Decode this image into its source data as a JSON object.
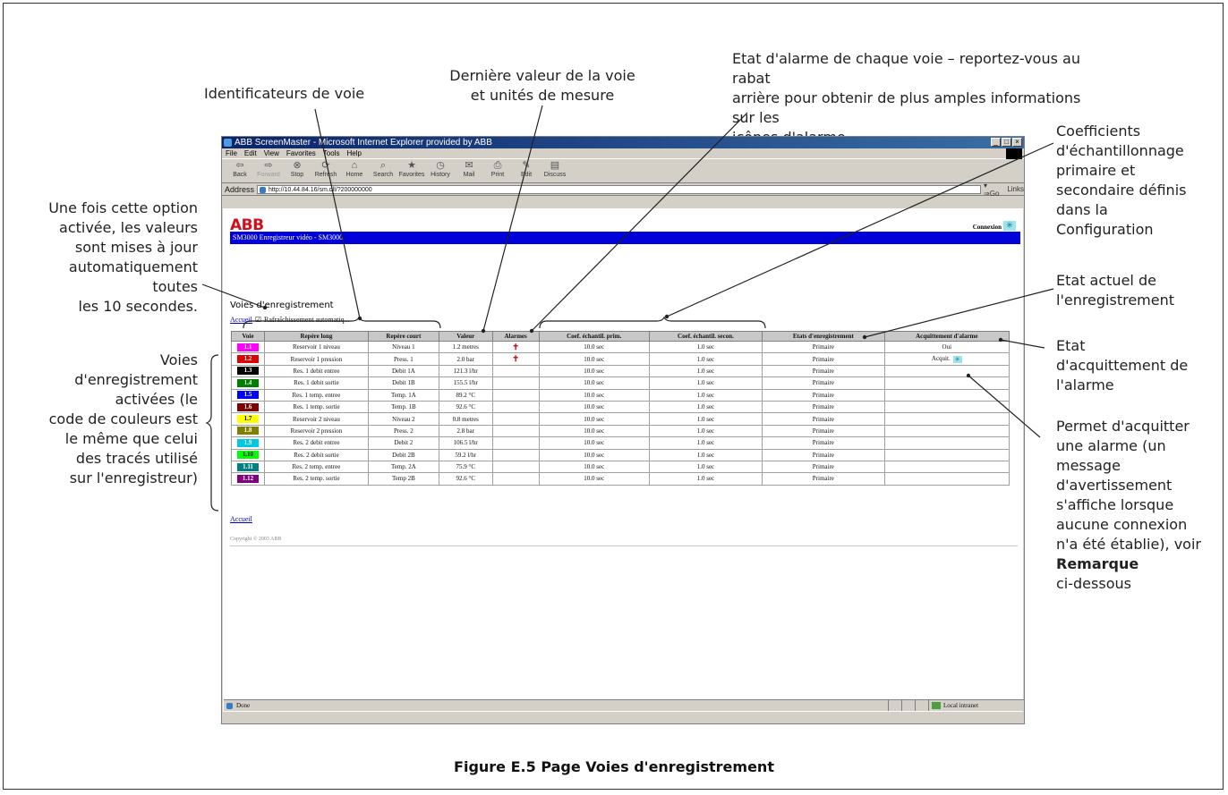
{
  "callouts": {
    "auto_refresh": [
      "Une fois cette option",
      "activée, les valeurs",
      "sont mises à jour",
      "automatiquement",
      "toutes",
      "les 10 secondes."
    ],
    "channel_ids": [
      "Identificateurs de voie"
    ],
    "last_value": [
      "Dernière valeur de la voie",
      "et unités de mesure"
    ],
    "alarm_state": [
      "Etat d'alarme de chaque voie – reportez-vous au rabat",
      "arrière pour obtenir de plus amples informations sur les",
      "icônes d'alarme"
    ],
    "sampling": [
      "Coefficients",
      "d'échantillonnage",
      "primaire et",
      "secondaire définis",
      "dans la",
      "Configuration"
    ],
    "recording_state": [
      "Etat actuel de",
      "l'enregistrement"
    ],
    "ack_state": [
      "Etat",
      "d'acquittement de",
      "l'alarme"
    ],
    "channels_enabled": [
      "Voies",
      "d'enregistrement",
      "activées (le",
      "code de couleurs est",
      "le même que celui",
      "des tracés utilisé",
      "sur l'enregistreur)"
    ],
    "ack_action": [
      "Permet d'acquitter",
      "une alarme (un",
      "message",
      "d'avertissement",
      "s'affiche lorsque",
      "aucune connexion",
      "n'a été établie), voir"
    ],
    "ack_note_bold": "Remarque",
    "ack_note_rest": "ci-dessous"
  },
  "caption": "Figure E.5 Page Voies d'enregistrement",
  "browser": {
    "title": "ABB ScreenMaster - Microsoft Internet Explorer provided by ABB",
    "menu": [
      "File",
      "Edit",
      "View",
      "Favorites",
      "Tools",
      "Help"
    ],
    "toolbar": [
      "Back",
      "Forward",
      "Stop",
      "Refresh",
      "Home",
      "Search",
      "Favorites",
      "History",
      "Mail",
      "Print",
      "Edit",
      "Discuss"
    ],
    "address_label": "Address",
    "address_value": "http://10.44.84.16/sm.dll/?200000000",
    "go_label": "Go",
    "links_label": "Links",
    "status_text": "Done",
    "zone_text": "Local intranet"
  },
  "page": {
    "logo": "ABB",
    "connexion_label": "Connexion",
    "banner": "SM3000 Enregistreur vidéo - SM3000",
    "heading": "Voies d'enregistrement",
    "home_link": "Accueil",
    "auto_refresh_label": "Rafraîchissement automatiq...",
    "footer_link": "Accueil",
    "copyright": "Copyright © 2003 ABB"
  },
  "table": {
    "headers": [
      "Voie",
      "Repère long",
      "Repère court",
      "Valeur",
      "Alarmes",
      "Coef. échantil. prim.",
      "Coef. échantil. secon.",
      "Etats d'enregistrement",
      "Acquittement d'alarme"
    ],
    "rows": [
      {
        "voie": "1.1",
        "color": "#ff00ff",
        "long": "Reservoir 1 niveau",
        "short": "Niveau 1",
        "value": "1.2 metres",
        "alarm": true,
        "prim": "10.0 sec",
        "sec": "1.0 sec",
        "state": "Primaire",
        "ack": "Oui",
        "ack_icon": false
      },
      {
        "voie": "1.2",
        "color": "#e00000",
        "long": "Reservoir 1 pression",
        "short": "Press. 1",
        "value": "2.0 bar",
        "alarm": true,
        "prim": "10.0 sec",
        "sec": "1.0 sec",
        "state": "Primaire",
        "ack": "Acquit.",
        "ack_icon": true
      },
      {
        "voie": "1.3",
        "color": "#000000",
        "long": "Res. 1 debit entree",
        "short": "Debit 1A",
        "value": "121.3 l/hr",
        "alarm": false,
        "prim": "10.0 sec",
        "sec": "1.0 sec",
        "state": "Primaire",
        "ack": "",
        "ack_icon": false
      },
      {
        "voie": "1.4",
        "color": "#008000",
        "long": "Res. 1 debit sortie",
        "short": "Debit 1B",
        "value": "155.5 l/hr",
        "alarm": false,
        "prim": "10.0 sec",
        "sec": "1.0 sec",
        "state": "Primaire",
        "ack": "",
        "ack_icon": false
      },
      {
        "voie": "1.5",
        "color": "#0000ff",
        "long": "Res. 1 temp. entree",
        "short": "Temp. 1A",
        "value": "89.2 °C",
        "alarm": false,
        "prim": "10.0 sec",
        "sec": "1.0 sec",
        "state": "Primaire",
        "ack": "",
        "ack_icon": false
      },
      {
        "voie": "1.6",
        "color": "#800000",
        "long": "Res. 1 temp. sortie",
        "short": "Temp. 1B",
        "value": "92.6 °C",
        "alarm": false,
        "prim": "10.0 sec",
        "sec": "1.0 sec",
        "state": "Primaire",
        "ack": "",
        "ack_icon": false
      },
      {
        "voie": "1.7",
        "color": "#ffff00",
        "long": "Reservoir 2 niveau",
        "short": "Niveau 2",
        "value": "0.8 metres",
        "alarm": false,
        "prim": "10.0 sec",
        "sec": "1.0 sec",
        "state": "Primaire",
        "ack": "",
        "ack_icon": false
      },
      {
        "voie": "1.8",
        "color": "#808000",
        "long": "Reservoir 2 pression",
        "short": "Press. 2",
        "value": "2.8 bar",
        "alarm": false,
        "prim": "10.0 sec",
        "sec": "1.0 sec",
        "state": "Primaire",
        "ack": "",
        "ack_icon": false
      },
      {
        "voie": "1.9",
        "color": "#00c8e0",
        "long": "Res. 2 debit entree",
        "short": "Debit 2",
        "value": "106.5 l/hr",
        "alarm": false,
        "prim": "10.0 sec",
        "sec": "1.0 sec",
        "state": "Primaire",
        "ack": "",
        "ack_icon": false
      },
      {
        "voie": "1.10",
        "color": "#00ff00",
        "long": "Res. 2 debit sortie",
        "short": "Debit 2B",
        "value": "59.2 l/hr",
        "alarm": false,
        "prim": "10.0 sec",
        "sec": "1.0 sec",
        "state": "Primaire",
        "ack": "",
        "ack_icon": false
      },
      {
        "voie": "1.11",
        "color": "#008080",
        "long": "Res. 2 temp. entree",
        "short": "Temp. 2A",
        "value": "75.9 °C",
        "alarm": false,
        "prim": "10.0 sec",
        "sec": "1.0 sec",
        "state": "Primaire",
        "ack": "",
        "ack_icon": false
      },
      {
        "voie": "1.12",
        "color": "#800080",
        "long": "Res. 2 temp. sortie",
        "short": "Temp 2B",
        "value": "92.6 °C",
        "alarm": false,
        "prim": "10.0 sec",
        "sec": "1.0 sec",
        "state": "Primaire",
        "ack": "",
        "ack_icon": false
      }
    ]
  }
}
